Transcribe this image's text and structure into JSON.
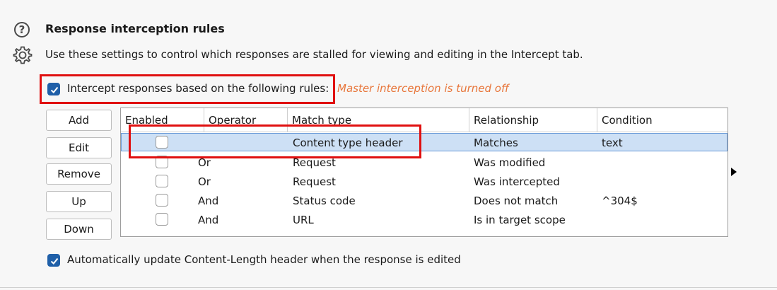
{
  "section": {
    "title": "Response interception rules",
    "description": "Use these settings to control which responses are stalled for viewing and editing in the Intercept tab."
  },
  "intercept_checkbox": {
    "label": "Intercept responses based on the following rules:",
    "checked": true,
    "status_note": "Master interception is turned off"
  },
  "buttons": {
    "add": "Add",
    "edit": "Edit",
    "remove": "Remove",
    "up": "Up",
    "down": "Down"
  },
  "table": {
    "columns": [
      "Enabled",
      "Operator",
      "Match type",
      "Relationship",
      "Condition"
    ],
    "rows": [
      {
        "enabled": false,
        "operator": "",
        "match_type": "Content type header",
        "relationship": "Matches",
        "condition": "text",
        "selected": true
      },
      {
        "enabled": false,
        "operator": "Or",
        "match_type": "Request",
        "relationship": "Was modified",
        "condition": ""
      },
      {
        "enabled": false,
        "operator": "Or",
        "match_type": "Request",
        "relationship": "Was intercepted",
        "condition": ""
      },
      {
        "enabled": false,
        "operator": "And",
        "match_type": "Status code",
        "relationship": "Does not match",
        "condition": "^304$"
      },
      {
        "enabled": false,
        "operator": "And",
        "match_type": "URL",
        "relationship": "Is in target scope",
        "condition": ""
      }
    ]
  },
  "auto_update_checkbox": {
    "label": "Automatically update Content-Length header when the response is edited",
    "checked": true
  },
  "colors": {
    "accent": "#1f5fa8",
    "warning": "#e8763b",
    "highlight_box": "#e01010",
    "selected_row": "#cde0f5"
  }
}
